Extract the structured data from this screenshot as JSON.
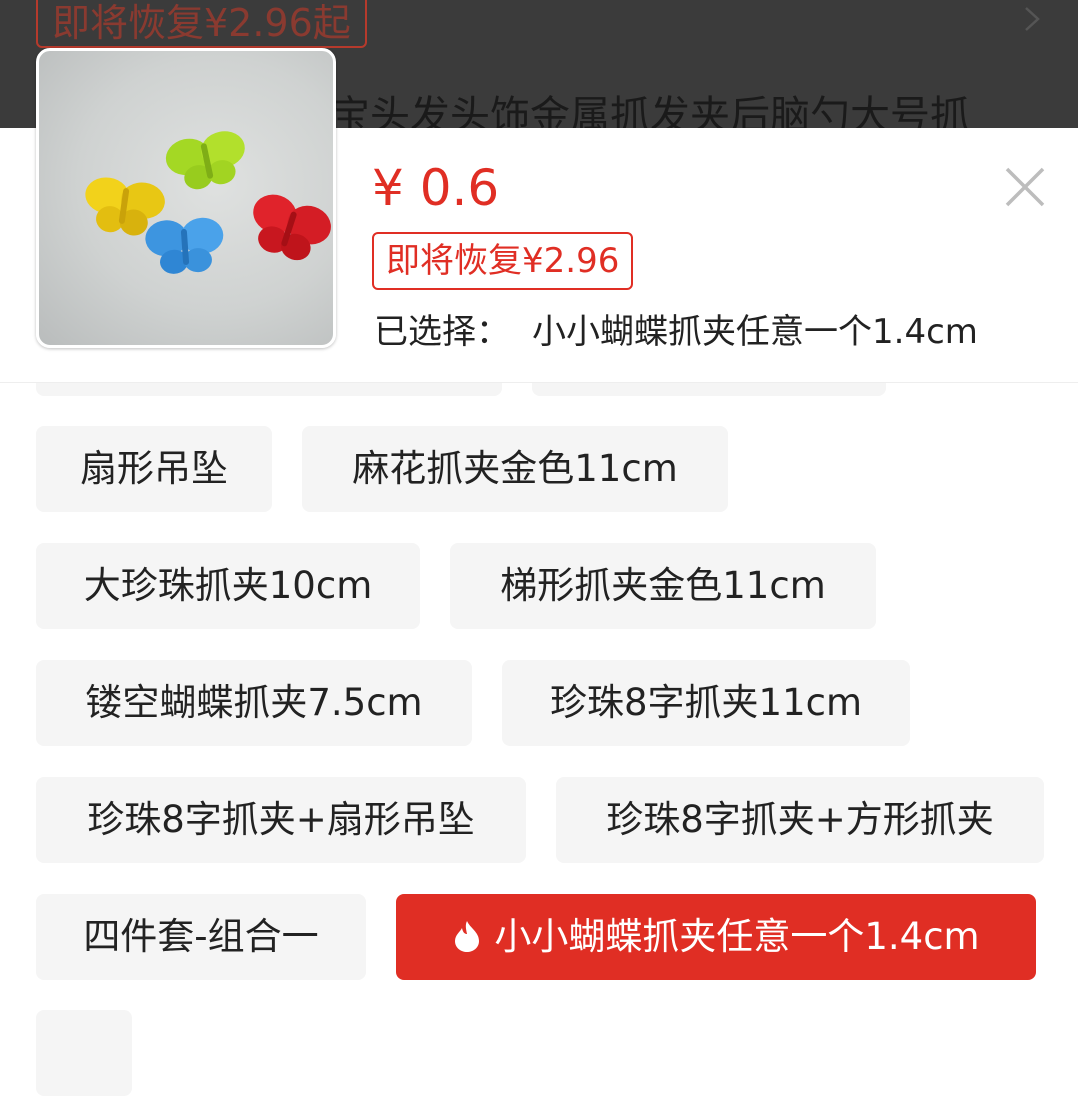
{
  "background_page": {
    "promo_tag": "即将恢复¥2.96起",
    "title_fragment": "宝头发头饰金属抓发夹后脑勺大号抓"
  },
  "sheet": {
    "price": "¥ 0.6",
    "restore_tag": "即将恢复¥2.96",
    "selected_label": "已选择：",
    "selected_value": "小小蝴蝶抓夹任意一个1.4cm",
    "accent_color": "#e02e24"
  },
  "options": [
    {
      "label": "扇形吊坠",
      "selected": false
    },
    {
      "label": "麻花抓夹金色11cm",
      "selected": false
    },
    {
      "label": "大珍珠抓夹10cm",
      "selected": false
    },
    {
      "label": "梯形抓夹金色11cm",
      "selected": false
    },
    {
      "label": "镂空蝴蝶抓夹7.5cm",
      "selected": false
    },
    {
      "label": "珍珠8字抓夹11cm",
      "selected": false
    },
    {
      "label": "珍珠8字抓夹+扇形吊坠",
      "selected": false
    },
    {
      "label": "珍珠8字抓夹+方形抓夹",
      "selected": false
    },
    {
      "label": "四件套-组合一",
      "selected": false
    },
    {
      "label": "小小蝴蝶抓夹任意一个1.4cm",
      "selected": true,
      "icon": "fire-icon"
    }
  ]
}
